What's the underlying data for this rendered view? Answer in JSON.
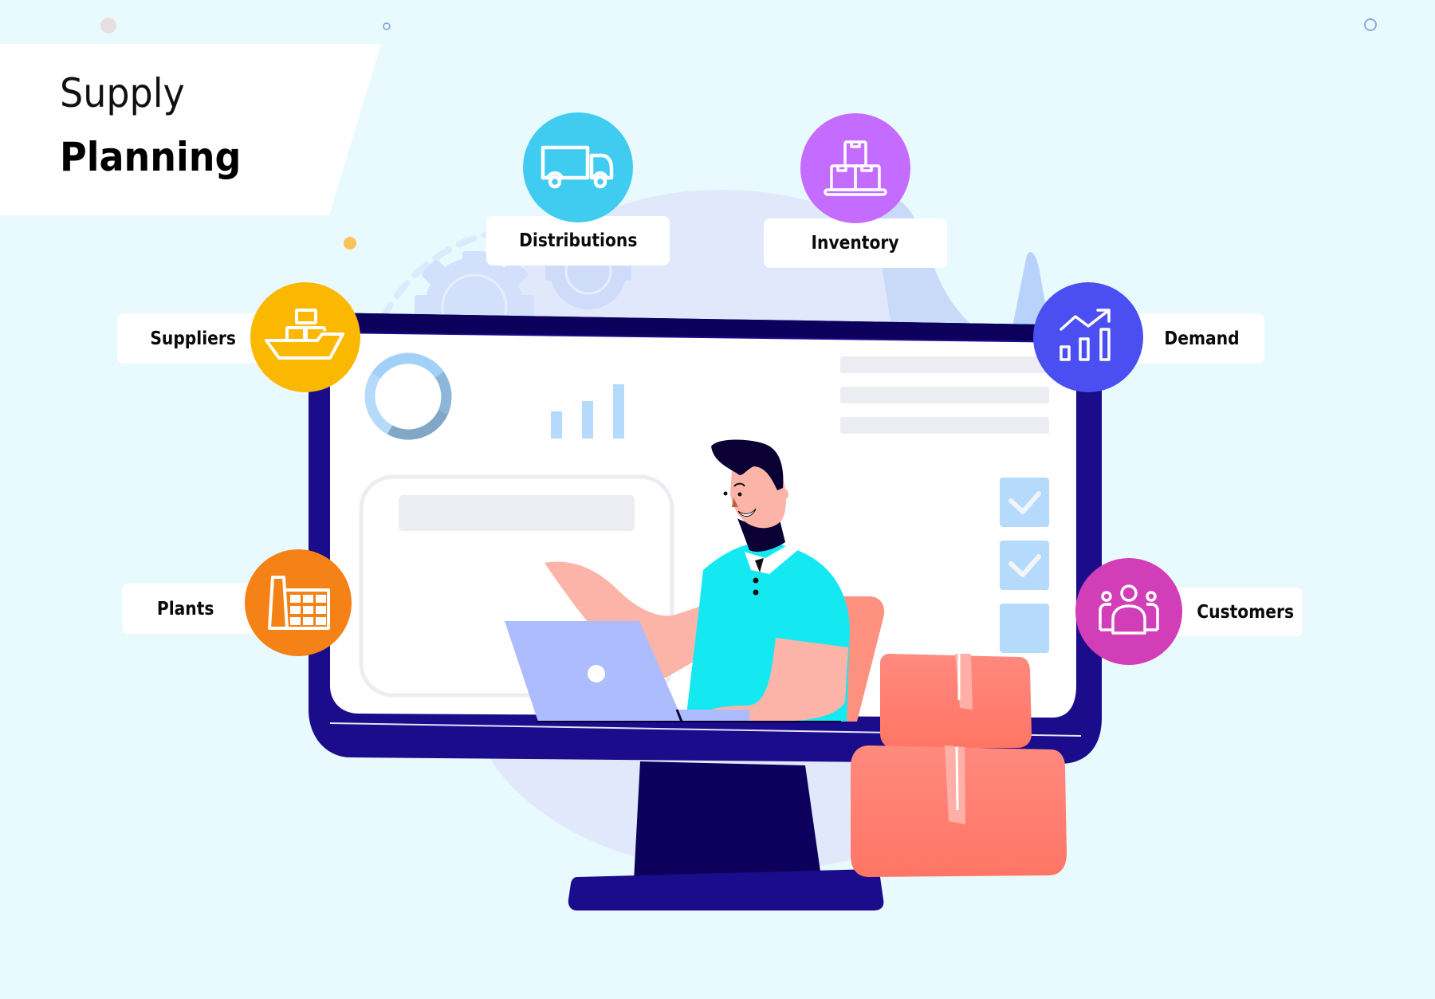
{
  "title": {
    "line1": "Supply",
    "line2": "Planning"
  },
  "nodes": [
    {
      "id": "distributions",
      "label": "Distributions",
      "icon": "truck-icon",
      "color": "#40ccf0"
    },
    {
      "id": "inventory",
      "label": "Inventory",
      "icon": "boxes-pallet-icon",
      "color": "#c46cff"
    },
    {
      "id": "suppliers",
      "label": "Suppliers",
      "icon": "cargo-ship-icon",
      "color": "#fbb800"
    },
    {
      "id": "demand",
      "label": "Demand",
      "icon": "trend-chart-icon",
      "color": "#4b4ff2"
    },
    {
      "id": "plants",
      "label": "Plants",
      "icon": "factory-icon",
      "color": "#f58216"
    },
    {
      "id": "customers",
      "label": "Customers",
      "icon": "people-group-icon",
      "color": "#d23db8"
    }
  ],
  "colors": {
    "background": "#e8fafe",
    "monitor_frame": "#1a0c8a",
    "monitor_dark": "#0c005c",
    "screen": "#ffffff",
    "placeholder": "#ecedf2",
    "chart_light": "#b5dafc",
    "box": "#ff8070",
    "shirt": "#14e9f2",
    "skin": "#fdb4a8",
    "laptop": "#adbcfd"
  }
}
